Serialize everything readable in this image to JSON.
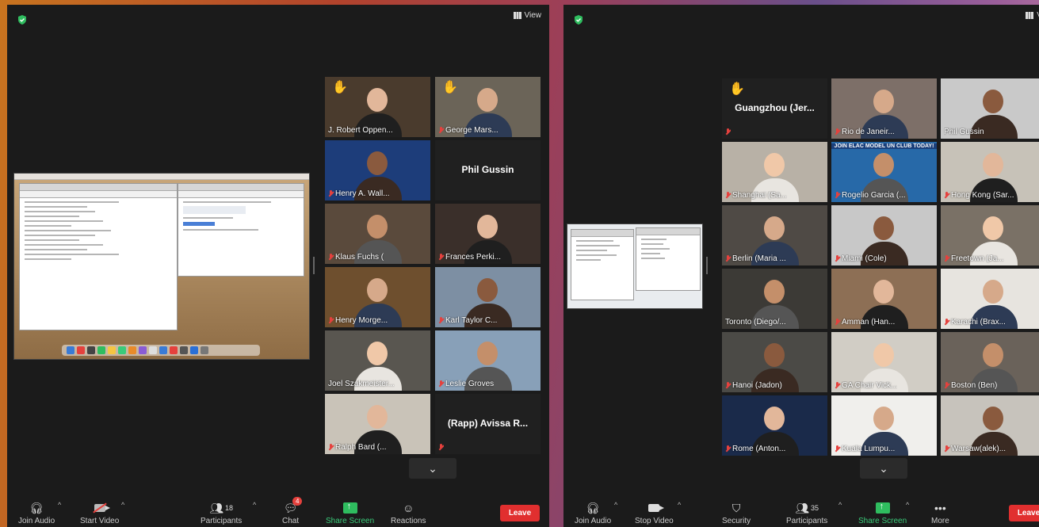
{
  "left_window": {
    "view_label": "View",
    "tiles": [
      {
        "name": "J. Robert Oppen...",
        "hand": true,
        "muted": false,
        "speaking": true
      },
      {
        "name": "George Mars...",
        "hand": true,
        "muted": true
      },
      {
        "name": "Henry A. Wall...",
        "muted": true
      },
      {
        "name": "Phil Gussin",
        "no_video": true
      },
      {
        "name": "Klaus Fuchs (",
        "muted": true
      },
      {
        "name": "Frances Perki...",
        "muted": true
      },
      {
        "name": "Henry Morge...",
        "muted": true
      },
      {
        "name": "Karl Taylor C...",
        "muted": true
      },
      {
        "name": "Joel Szakmeister...",
        "muted": false
      },
      {
        "name": "Leslie Groves",
        "muted": true
      },
      {
        "name": "Ralph Bard (...",
        "muted": true
      },
      {
        "name": "(Rapp) Avissa R...",
        "no_video": true,
        "muted": true
      }
    ],
    "toolbar": {
      "join_audio": "Join Audio",
      "start_video": "Start Video",
      "participants": "Participants",
      "participants_count": "18",
      "chat": "Chat",
      "chat_badge": "4",
      "share_screen": "Share Screen",
      "reactions": "Reactions",
      "leave": "Leave"
    }
  },
  "right_window": {
    "view_label": "Vi",
    "tiles": [
      {
        "name": "Guangzhou (Jer...",
        "hand": true,
        "no_video": true,
        "muted": true
      },
      {
        "name": "Rio de Janeir...",
        "muted": true
      },
      {
        "name": "Phil Gussin",
        "muted": false
      },
      {
        "name": "Shanghai (Sa...",
        "muted": true
      },
      {
        "name": "Rogelio Garcia (...",
        "muted": true
      },
      {
        "name": "Hong Kong (Sar...",
        "muted": true,
        "speaking": true
      },
      {
        "name": "Berlin (Maria ...",
        "muted": true
      },
      {
        "name": "Miami (Cole)",
        "muted": true
      },
      {
        "name": "Freetown (Ja...",
        "muted": true
      },
      {
        "name": "Toronto (Diego/...",
        "muted": false
      },
      {
        "name": "Amman (Han...",
        "muted": true
      },
      {
        "name": "Karachi (Brax...",
        "muted": true
      },
      {
        "name": "Hanoi (Jadon)",
        "muted": true
      },
      {
        "name": "GA Chair Vick...",
        "muted": true
      },
      {
        "name": "Boston (Ben)",
        "muted": true
      },
      {
        "name": "Rome (Anton...",
        "muted": true
      },
      {
        "name": "Kuala Lumpu...",
        "muted": true
      },
      {
        "name": "Warsaw(alek)...",
        "muted": true
      }
    ],
    "banner_text": "JOIN ELAC MODEL UN CLUB TODAY!",
    "toolbar": {
      "join_audio": "Join Audio",
      "stop_video": "Stop Video",
      "security": "Security",
      "participants": "Participants",
      "participants_count": "35",
      "share_screen": "Share Screen",
      "more": "More",
      "leave": "Leave"
    }
  },
  "colors": {
    "window_bg": "#1b1b1b",
    "speaker_border": "#d8df49",
    "leave_red": "#e12f2f",
    "share_green": "#2fbd5f",
    "muted_red": "#e5413d"
  }
}
